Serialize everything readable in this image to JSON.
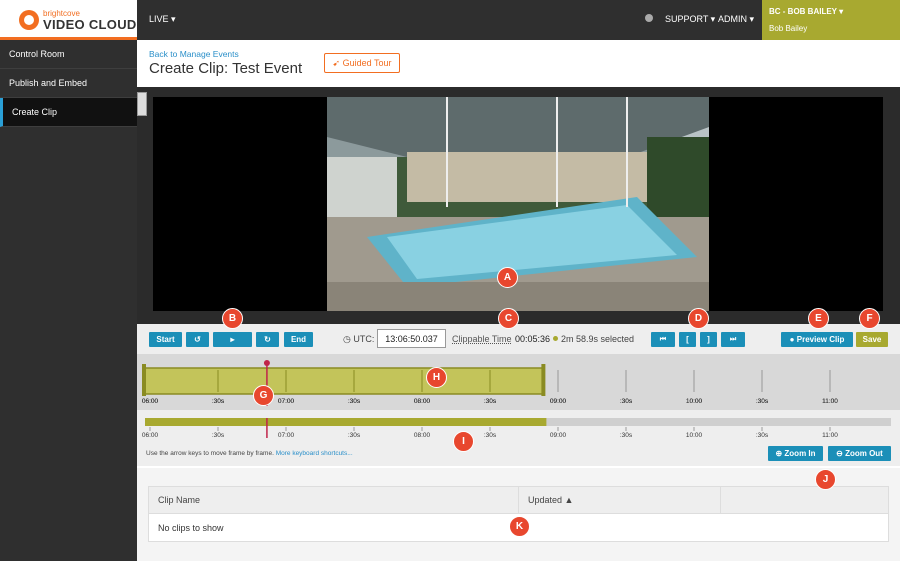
{
  "app": {
    "brand_small": "brightcove",
    "brand_big": "VIDEO CLOUD",
    "accent_color": "#f26e21",
    "brand_green": "#a8a930",
    "button_blue": "#1b8fb8"
  },
  "topnav": {
    "live": "LIVE ▾",
    "support": "SUPPORT ▾",
    "admin": "ADMIN ▾",
    "account_name": "BC - BOB BAILEY ▾",
    "account_user": "Bob Bailey",
    "user_icon": "person-icon"
  },
  "sidebar": {
    "items": [
      {
        "label": "Control Room"
      },
      {
        "label": "Publish and Embed"
      },
      {
        "label": "Create Clip"
      }
    ]
  },
  "header": {
    "back_link": "Back to Manage Events",
    "title": "Create Clip: Test Event",
    "guided_tour": "Guided Tour"
  },
  "controls": {
    "start": "Start",
    "rewind_icon": "rewind-10-icon",
    "play_icon": "play-icon",
    "forward_icon": "forward-10-icon",
    "end": "End",
    "utc_label": "UTC:",
    "utc_value": "13:06:50.037",
    "clippable_label": "Clippable Time",
    "clippable_value": "00:05:36",
    "selected_text": "2m 58.9s selected",
    "prev_frame": "⏮",
    "mark_in": "[",
    "mark_out": "]",
    "next_frame": "⏭",
    "preview_clip": "Preview Clip",
    "save": "Save"
  },
  "timeline": {
    "tick_labels": [
      "06:00",
      ":30s",
      "07:00",
      ":30s",
      "08:00",
      ":30s",
      "09:00",
      ":30s",
      "10:00",
      ":30s",
      "11:00"
    ],
    "selection_start_fraction": 0.0,
    "selection_end_fraction": 0.537,
    "playhead_fraction": 0.158,
    "hint_text": "Use the arrow keys to move frame by frame.",
    "hint_link": "More keyboard shortcuts...",
    "zoom_in": "Zoom In",
    "zoom_out": "Zoom Out"
  },
  "table": {
    "columns": [
      "Clip Name",
      "Updated ▲",
      ""
    ],
    "empty_message": "No clips to show"
  },
  "markers": [
    "A",
    "B",
    "C",
    "D",
    "E",
    "F",
    "G",
    "H",
    "I",
    "J",
    "K"
  ]
}
